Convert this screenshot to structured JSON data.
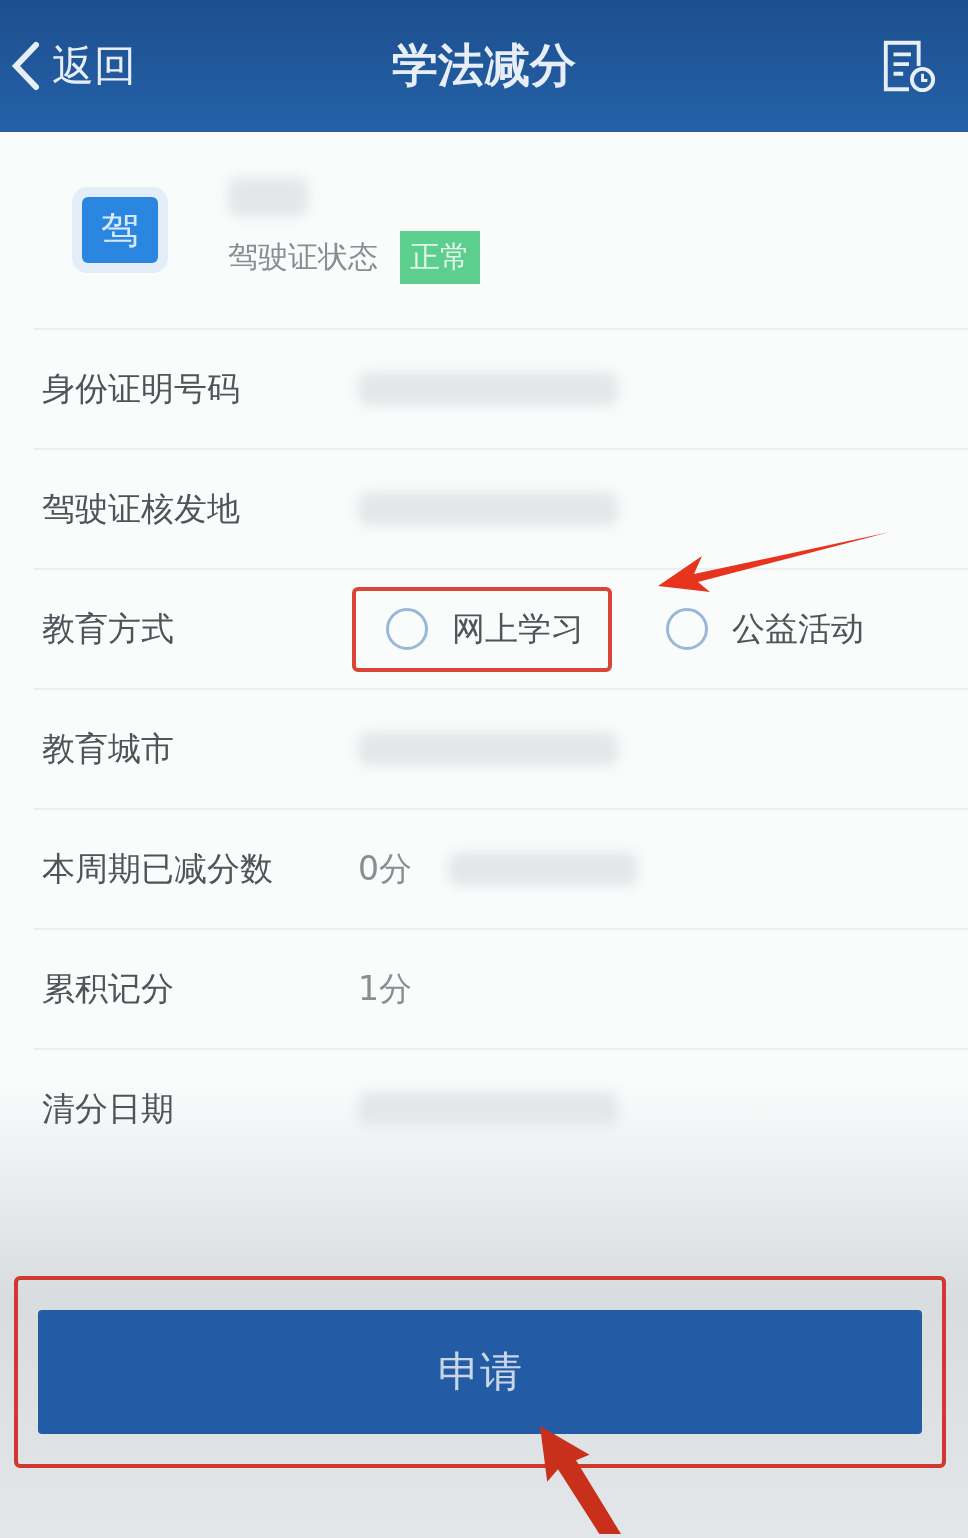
{
  "header": {
    "back": "返回",
    "title": "学法减分"
  },
  "license": {
    "badge_char": "驾",
    "status_label": "驾驶证状态",
    "status": "正常"
  },
  "rows": [
    {
      "label": "身份证明号码",
      "kind": "text",
      "redacted": true
    },
    {
      "label": "驾驶证核发地",
      "kind": "text",
      "redacted": true
    },
    {
      "label": "教育方式",
      "kind": "radio",
      "options": [
        {
          "label": "网上学习",
          "selected": false,
          "highlighted": true
        },
        {
          "label": "公益活动",
          "selected": false,
          "highlighted": false
        }
      ]
    },
    {
      "label": "教育城市",
      "kind": "text",
      "redacted": true
    },
    {
      "label": "本周期已减分数",
      "kind": "text",
      "value": "0分",
      "redacted": true
    },
    {
      "label": "累积记分",
      "kind": "text",
      "value": "1分"
    },
    {
      "label": "清分日期",
      "kind": "text",
      "redacted": true
    }
  ],
  "submit": {
    "label": "申请",
    "highlighted": true
  }
}
